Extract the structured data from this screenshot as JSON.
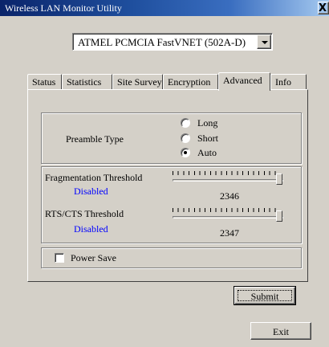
{
  "window": {
    "title": "Wireless LAN Monitor Utility",
    "close_glyph": "X"
  },
  "adapter_select": {
    "value": "ATMEL PCMCIA FastVNET (502A-D)"
  },
  "tabs": [
    {
      "label": "Status"
    },
    {
      "label": "Statistics"
    },
    {
      "label": "Site Survey"
    },
    {
      "label": "Encryption"
    },
    {
      "label": "Advanced",
      "active": true
    },
    {
      "label": "Info"
    }
  ],
  "preamble": {
    "label": "Preamble Type",
    "options": [
      {
        "label": "Long",
        "selected": false
      },
      {
        "label": "Short",
        "selected": false
      },
      {
        "label": "Auto",
        "selected": true
      }
    ]
  },
  "fragmentation": {
    "label": "Fragmentation Threshold",
    "status": "Disabled",
    "value": "2346",
    "slider_fraction": 0.98
  },
  "rts": {
    "label": "RTS/CTS Threshold",
    "status": "Disabled",
    "value": "2347",
    "slider_fraction": 0.98
  },
  "power_save": {
    "label": "Power Save",
    "checked": false
  },
  "submit_label": "Submit",
  "exit_label": "Exit",
  "colors": {
    "titlebar": "#0a246a",
    "face": "#d4d0c8",
    "disabled_text": "#0000ff"
  }
}
